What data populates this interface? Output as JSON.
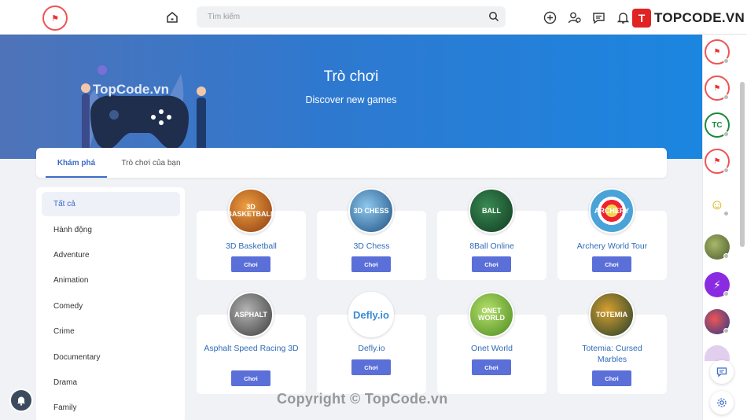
{
  "header": {
    "logo_text": "⚑",
    "search_placeholder": "Tìm kiếm",
    "brand_mark": "T",
    "brand_text": "TOPCODE.VN"
  },
  "banner": {
    "title": "Trò chơi",
    "subtitle": "Discover new games",
    "watermark": "TopCode.vn"
  },
  "tabs": [
    {
      "label": "Khám phá",
      "active": true
    },
    {
      "label": "Trò chơi của bạn",
      "active": false
    }
  ],
  "categories": [
    {
      "label": "Tất cả",
      "active": true
    },
    {
      "label": "Hành động"
    },
    {
      "label": "Adventure"
    },
    {
      "label": "Animation"
    },
    {
      "label": "Comedy"
    },
    {
      "label": "Crime"
    },
    {
      "label": "Documentary"
    },
    {
      "label": "Drama"
    },
    {
      "label": "Family"
    }
  ],
  "games": [
    {
      "name": "3D Basketball",
      "thumb_text": "3D BASKETBALL",
      "play": "Chơi",
      "color": "#c86a1c"
    },
    {
      "name": "3D Chess",
      "thumb_text": "3D CHESS",
      "play": "Chơi",
      "color": "#2d6fa8"
    },
    {
      "name": "8Ball Online",
      "thumb_text": "BALL",
      "play": "Chơi",
      "color": "#1d5a34"
    },
    {
      "name": "Archery World Tour",
      "thumb_text": "ARCHERY",
      "play": "Chơi",
      "color": "#4aa3d8"
    },
    {
      "name": "Asphalt Speed Racing 3D",
      "thumb_text": "ASPHALT",
      "play": "Chơi",
      "color": "#5a5a5a"
    },
    {
      "name": "Defly.io",
      "thumb_text": "Defly.io",
      "play": "Chơi",
      "color": "#ffffff"
    },
    {
      "name": "Onet World",
      "thumb_text": "ONET WORLD",
      "play": "Chơi",
      "color": "#7ab83a"
    },
    {
      "name": "Totemia: Cursed Marbles",
      "thumb_text": "TOTEMIA",
      "play": "Chơi",
      "color": "#1e3d2a"
    }
  ],
  "rail_avatars": [
    {
      "text": "⚑",
      "bg": "#ffffff",
      "fg": "#e33"
    },
    {
      "text": "⚑",
      "bg": "#ffffff",
      "fg": "#e33"
    },
    {
      "text": "TC",
      "bg": "#ffffff",
      "fg": "#1a8a3c"
    },
    {
      "text": "⚑",
      "bg": "#ffffff",
      "fg": "#e33"
    },
    {
      "text": "☺",
      "bg": "#ffffff",
      "fg": "#d4b000"
    },
    {
      "text": "",
      "bg": "#6b7a3a",
      "fg": "#fff"
    },
    {
      "text": "⚡",
      "bg": "#8a2be2",
      "fg": "#fff"
    },
    {
      "text": "",
      "bg": "#c0392b",
      "fg": "#fff"
    },
    {
      "text": "",
      "bg": "#d9c6e8",
      "fg": "#fff"
    }
  ],
  "copyright": "Copyright © TopCode.vn",
  "colors": {
    "accent": "#3d6bc6",
    "play_button": "#5b6fd8",
    "banner_start": "#4f73b8",
    "banner_end": "#1b86e0"
  }
}
